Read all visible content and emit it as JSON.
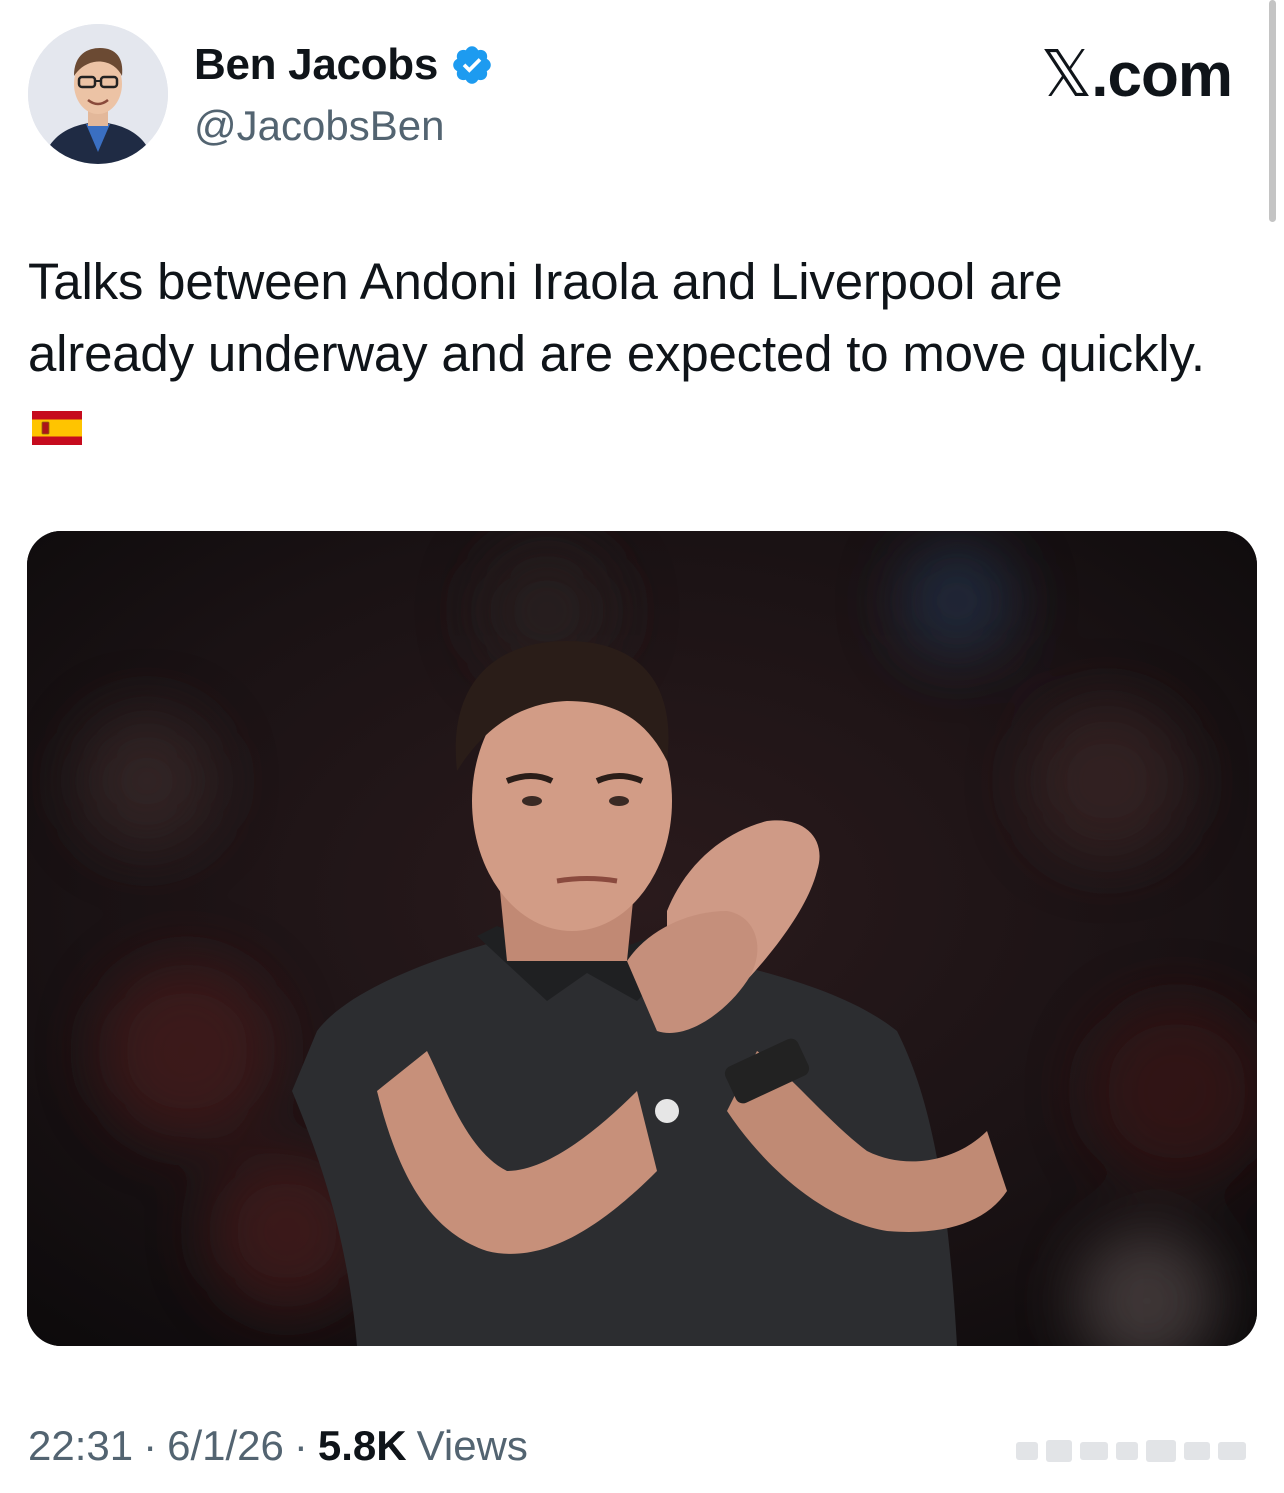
{
  "author": {
    "display_name": "Ben Jacobs",
    "handle": "@JacobsBen",
    "verified": true,
    "avatar_icon": "profile-photo"
  },
  "brand": {
    "label": ".com",
    "logo_icon": "x-logo-icon"
  },
  "tweet": {
    "text": "Talks between Andoni Iraola and Liverpool are already underway and are expected to move quickly.",
    "emoji": "spain-flag-icon",
    "media_icon": "photo-manager-applauding"
  },
  "meta": {
    "time": "22:31",
    "separator": "·",
    "date": "6/1/26",
    "views_count": "5.8K",
    "views_label": "Views"
  },
  "colors": {
    "text_primary": "#0f1419",
    "text_secondary": "#536471",
    "verified_blue": "#1d9bf0"
  }
}
